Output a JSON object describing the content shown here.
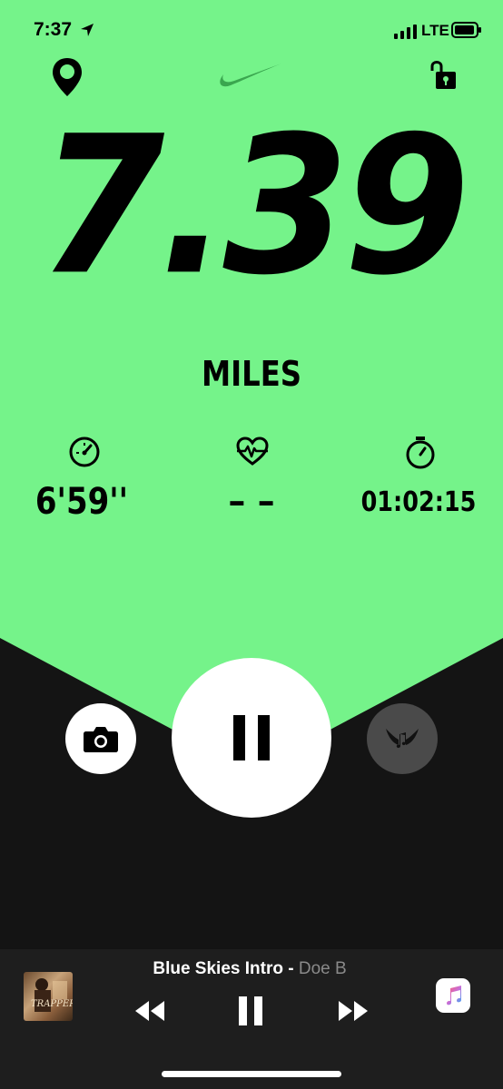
{
  "status_bar": {
    "time": "7:37",
    "network": "LTE"
  },
  "run": {
    "distance": "7.39",
    "unit": "MILES",
    "pace": "6'59''",
    "heart_rate": "– –",
    "duration": "01:02:15"
  },
  "colors": {
    "accent_green": "#75F38A",
    "background": "#141414",
    "pin_green": "#75F38A"
  },
  "icons": [
    "location-pin-icon",
    "nike-swoosh-icon",
    "unlocked-lock-icon",
    "speedometer-icon",
    "heart-rate-icon",
    "stopwatch-icon",
    "camera-icon",
    "pause-icon",
    "music-wings-icon",
    "rewind-icon",
    "fast-forward-icon",
    "apple-music-icon"
  ],
  "now_playing": {
    "song": "Blue Skies Intro",
    "separator": " - ",
    "artist": "Doe B",
    "album_art_text": "TRAPPER"
  }
}
